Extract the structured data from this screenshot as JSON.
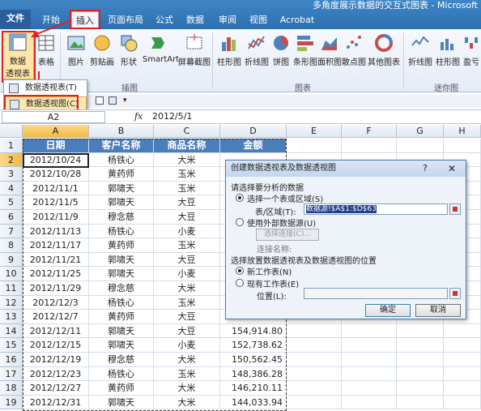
{
  "titlebar": {
    "document_title": "多角度展示数据的交互式图表 - Microsoft"
  },
  "tabs": [
    "文件",
    "开始",
    "插入",
    "页面布局",
    "公式",
    "数据",
    "审阅",
    "视图",
    "Acrobat"
  ],
  "ribbon": {
    "pivot_button": "数据透视表",
    "pivot_button_line1": "数据",
    "pivot_button_line2": "透视表",
    "table": "表格",
    "picture": "图片",
    "clipart": "剪贴画",
    "shapes": "形状",
    "smartart": "SmartArt",
    "screenshot": "屏幕截图",
    "illustrations_group": "插图",
    "charts": [
      "柱形图",
      "折线图",
      "饼图",
      "条形图",
      "面积图",
      "散点图",
      "其他图表"
    ],
    "charts_group": "图表",
    "sparklines": [
      "折线图",
      "柱形图",
      "盈亏"
    ],
    "sparklines_group": "迷你图"
  },
  "dropdown": {
    "items": [
      "数据透视表(T)",
      "数据透视图(C)"
    ]
  },
  "formula_bar": {
    "name_box": "A2",
    "fx": "fx",
    "value": "2012/5/1"
  },
  "grid": {
    "columns": [
      "A",
      "B",
      "C",
      "D",
      "E",
      "F",
      "G",
      "H"
    ],
    "headers": [
      "日期",
      "客户名称",
      "商品名称",
      "金额"
    ],
    "rows": [
      [
        "2012/10/24",
        "杨铁心",
        "大米",
        ""
      ],
      [
        "2012/10/28",
        "黄药师",
        "玉米",
        ""
      ],
      [
        "2012/11/1",
        "郭啸天",
        "玉米",
        ""
      ],
      [
        "2012/11/5",
        "郭啸天",
        "大豆",
        ""
      ],
      [
        "2012/11/9",
        "穆念慈",
        "大豆",
        ""
      ],
      [
        "2012/11/13",
        "杨铁心",
        "小麦",
        ""
      ],
      [
        "2012/11/17",
        "黄药师",
        "玉米",
        ""
      ],
      [
        "2012/11/21",
        "郭啸天",
        "大豆",
        ""
      ],
      [
        "2012/11/25",
        "郭啸天",
        "小麦",
        ""
      ],
      [
        "2012/11/29",
        "穆念慈",
        "大米",
        ""
      ],
      [
        "2012/12/3",
        "杨铁心",
        "玉米",
        ""
      ],
      [
        "2012/12/7",
        "黄药师",
        "大豆",
        ""
      ],
      [
        "2012/12/11",
        "郭啸天",
        "大豆",
        "154,914.80"
      ],
      [
        "2012/12/15",
        "郭啸天",
        "小麦",
        "152,738.62"
      ],
      [
        "2012/12/19",
        "穆念慈",
        "大米",
        "150,562.45"
      ],
      [
        "2012/12/23",
        "杨铁心",
        "玉米",
        "148,386.28"
      ],
      [
        "2012/12/27",
        "黄药师",
        "大米",
        "146,210.11"
      ],
      [
        "2012/12/31",
        "郭啸天",
        "大米",
        "144,033.94"
      ]
    ]
  },
  "dialog": {
    "title": "创建数据透视表及数据透视图",
    "help": "?",
    "close": "✕",
    "section1": "请选择要分析的数据",
    "opt_select": "选择一个表或区域(S)",
    "range_label": "表/区域(T):",
    "range_value": "数据源!$A$1:$D$63",
    "opt_external": "使用外部数据源(U)",
    "choose_conn": "选择连接(C)...",
    "conn_name": "连接名称:",
    "section2": "选择放置数据透视表及数据透视图的位置",
    "opt_new": "新工作表(N)",
    "opt_existing": "现有工作表(E)",
    "location_label": "位置(L):",
    "ok": "确定",
    "cancel": "取消"
  }
}
